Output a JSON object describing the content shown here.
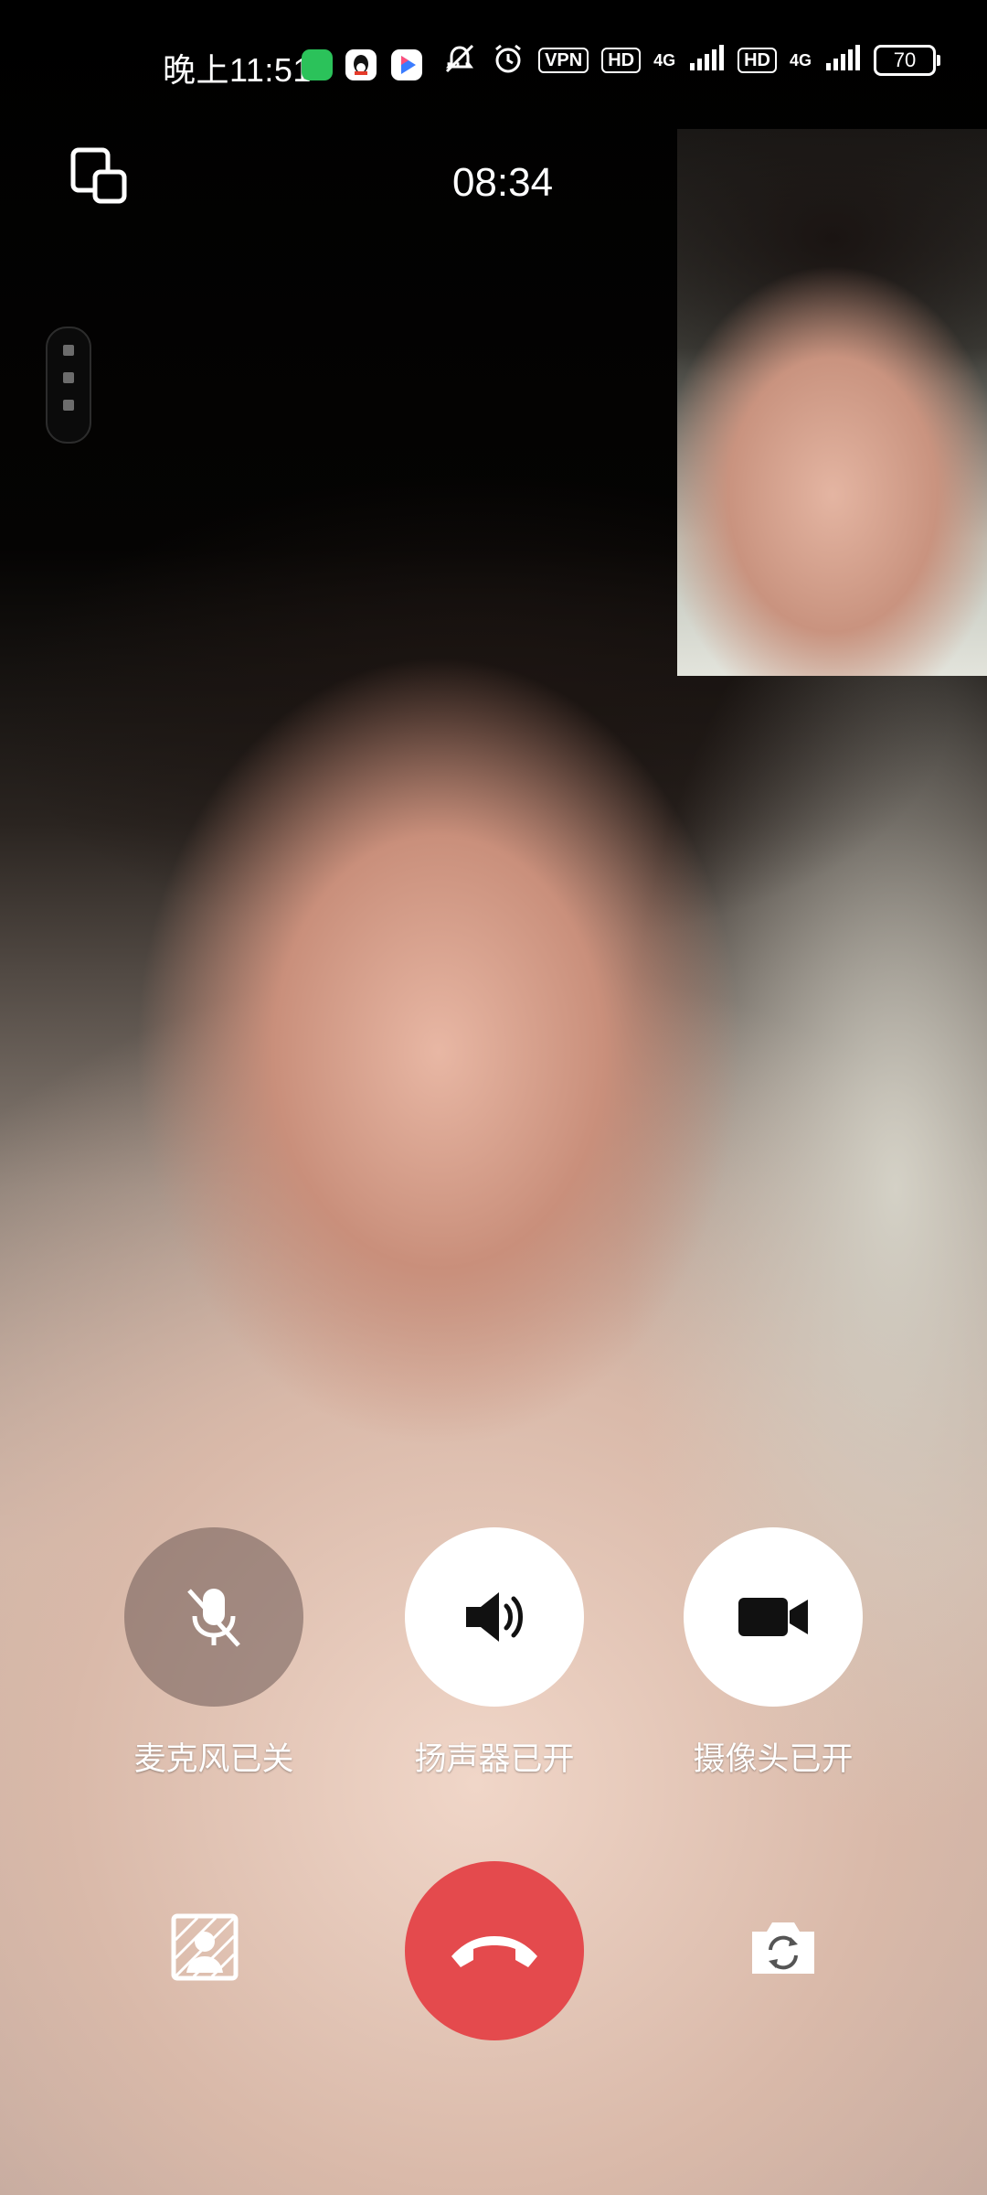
{
  "status_bar": {
    "time": "晚上11:51",
    "icons": [
      "wechat-icon",
      "qq-icon",
      "video-app-icon",
      "more-dots-icon",
      "mute-icon",
      "alarm-icon"
    ],
    "vpn_label": "VPN",
    "hd_label": "HD",
    "network_label": "4G",
    "battery_level": "70"
  },
  "call": {
    "timer": "08:34"
  },
  "controls": {
    "mic_label": "麦克风已关",
    "speaker_label": "扬声器已开",
    "camera_label": "摄像头已开"
  },
  "colors": {
    "hangup": "#e44a4d",
    "control_active": "#ffffff",
    "control_off": "#6e5a55"
  }
}
